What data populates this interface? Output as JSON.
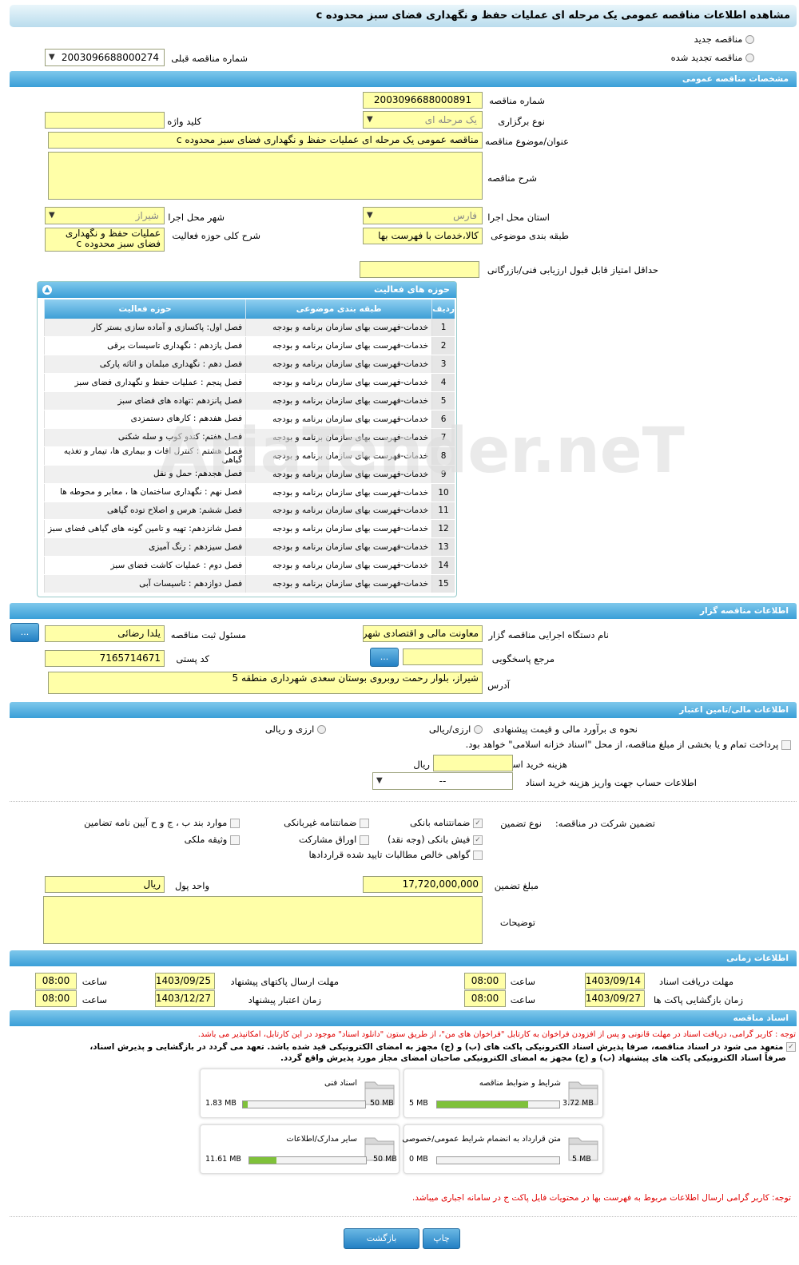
{
  "title": "مشاهده اطلاعات مناقصه عمومی یک مرحله ای عملیات حفظ و نگهداری فضای سبز محدوده c",
  "top": {
    "new_label": "مناقصه جدید",
    "renewed_label": "مناقصه تجدید شده",
    "prev_number_label": "شماره مناقصه قبلی",
    "prev_number_value": "2003096688000274"
  },
  "general": {
    "header": "مشخصات مناقصه عمومی",
    "number_label": "شماره مناقصه",
    "number_value": "2003096688000891",
    "type_label": "نوع برگزاری",
    "type_value": "یک مرحله ای",
    "keyword_label": "کلید واژه",
    "keyword_value": "",
    "subject_label": "عنوان/موضوع مناقصه",
    "subject_value": "مناقصه عمومی یک مرحله ای عملیات حفظ و نگهداری فضای سبز محدوده c",
    "desc_label": "شرح مناقصه",
    "desc_value": "",
    "province_label": "استان محل اجرا",
    "province_value": "فارس",
    "city_label": "شهر محل اجرا",
    "city_value": "شیراز",
    "category_label": "طبقه بندی موضوعی",
    "category_value": "کالا،خدمات با فهرست بها",
    "scope_label": "شرح کلی حوزه فعالیت",
    "scope_value": "عملیات حفظ و نگهداری فضای سبز محدوده c",
    "min_score_label": "حداقل امتیاز قابل قبول ارزیابی فنی/بازرگانی",
    "min_score_value": ""
  },
  "activities": {
    "header": "حوزه های فعالیت",
    "col_no": "ردیف",
    "col_cat": "طبقه بندی موضوعی",
    "col_act": "حوزه فعالیت",
    "rows": [
      [
        "1",
        "خدمات-فهرست بهای سازمان برنامه و بودجه",
        "فصل اول:  پاکسازی و آماده سازی بستر کار"
      ],
      [
        "2",
        "خدمات-فهرست بهای سازمان برنامه و بودجه",
        "فصل یازدهم : نگهداری تاسیسات برقی"
      ],
      [
        "3",
        "خدمات-فهرست بهای سازمان برنامه و بودجه",
        "فصل دهم : نگهداری مبلمان و اثاثه پارکی"
      ],
      [
        "4",
        "خدمات-فهرست بهای سازمان برنامه و بودجه",
        "فصل پنجم : عملیات حفظ و نگهداری فضای سبز"
      ],
      [
        "5",
        "خدمات-فهرست بهای سازمان برنامه و بودجه",
        "فصل پانزدهم :تهاده های فضای سبز"
      ],
      [
        "6",
        "خدمات-فهرست بهای سازمان برنامه و بودجه",
        "فصل هفدهم : کارهای دستمزدی"
      ],
      [
        "7",
        "خدمات-فهرست بهای سازمان برنامه و بودجه",
        "فصل هفتم: کندو کوب و سله شکنی"
      ],
      [
        "8",
        "خدمات-فهرست بهای سازمان برنامه و بودجه",
        "فصل هشتم : کنترل آفات و بیماری ها، تیمار و تغذیه گیاهی"
      ],
      [
        "9",
        "خدمات-فهرست بهای سازمان برنامه و بودجه",
        "فصل هجدهم: حمل و نقل"
      ],
      [
        "10",
        "خدمات-فهرست بهای سازمان برنامه و بودجه",
        "فصل نهم : نگهداری ساختمان ها ، معابر و محوطه ها"
      ],
      [
        "11",
        "خدمات-فهرست بهای سازمان برنامه و بودجه",
        "فصل ششم: هرس و اصلاح توده گیاهی"
      ],
      [
        "12",
        "خدمات-فهرست بهای سازمان برنامه و بودجه",
        "فصل شانزدهم: تهیه و تامین گونه های گیاهی فضای سبز"
      ],
      [
        "13",
        "خدمات-فهرست بهای سازمان برنامه و بودجه",
        "فصل سیزدهم : رنگ آمیزی"
      ],
      [
        "14",
        "خدمات-فهرست بهای سازمان برنامه و بودجه",
        "فصل دوم : عملیات کاشت فضای سبز"
      ],
      [
        "15",
        "خدمات-فهرست بهای سازمان برنامه و بودجه",
        "فصل دوازدهم : تاسیسات آبی"
      ]
    ]
  },
  "organizer": {
    "header": "اطلاعات مناقصه گزار",
    "org_label": "نام دستگاه اجرایی مناقصه گزار",
    "org_value": "معاونت مالی و اقتصادی شهرداری شیراز",
    "resp_label": "مسئول ثبت مناقصه",
    "resp_value": "یلدا رضائی",
    "ref_label": "مرجع پاسخگویی",
    "ref_value": "",
    "postal_label": "کد پستی",
    "postal_value": "7165714671",
    "address_label": "آدرس",
    "address_value": "شیراز، بلوار رحمت روبروی بوستان سعدی شهرداری  منطقه 5",
    "btn_label": "..."
  },
  "finance": {
    "header": "اطلاعات مالی/تامین اعتبار",
    "estimate_label": "نحوه ی برآورد مالی و قیمت پیشنهادی",
    "opt1": "ارزی/ریالی",
    "opt2": "ارزی و ریالی",
    "treasury_text": "پرداخت تمام و یا بخشی از مبلغ مناقصه، از محل \"اسناد خزانه اسلامی\" خواهد بود.",
    "doc_fee_label": "هزینه خرید اسناد",
    "doc_fee_unit": "ریال",
    "doc_fee_value": "",
    "account_label": "اطلاعات حساب جهت واریز هزینه خرید اسناد",
    "account_value": "--"
  },
  "guarantee": {
    "label": "تضمین شرکت در مناقصه:",
    "type_label": "نوع تضمین",
    "opts": [
      "ضمانتنامه بانکی",
      "ضمانتنامه غیربانکی",
      "موارد بند ب ، ج و ح آیین نامه تضامین",
      "فیش بانکی (وجه نقد)",
      "اوراق مشارکت",
      "وثیقه ملکی",
      "گواهی خالص مطالبات تایید شده قراردادها"
    ],
    "amount_label": "مبلغ تضمین",
    "amount_value": "17,720,000,000",
    "currency_label": "واحد پول",
    "currency_value": "ریال",
    "notes_label": "توضیحات",
    "notes_value": ""
  },
  "timing": {
    "header": "اطلاعات زمانی",
    "doc_receive_label": "مهلت دریافت اسناد",
    "doc_receive_date": "1403/09/14",
    "doc_receive_time": "08:00",
    "send_label": "مهلت ارسال پاکتهای پیشنهاد",
    "send_date": "1403/09/25",
    "send_time": "08:00",
    "open_label": "زمان بازگشایی پاکت ها",
    "open_date": "1403/09/27",
    "open_time": "08:00",
    "valid_label": "زمان اعتبار پیشنهاد",
    "valid_date": "1403/12/27",
    "valid_time": "08:00",
    "time_label": "ساعت"
  },
  "docs": {
    "header": "اسناد مناقصه",
    "note1": "توجه : کاربر گرامی، دریافت اسناد در مهلت قانونی و پس از افزودن فراخوان به کارتابل \"فراخوان های من\"، از طریق ستون \"دانلود اسناد\" موجود در این کارتابل، امکانپذیر می باشد.",
    "note2a": "متعهد می شود در اسناد مناقصه، صرفاً پذیرش اسناد الکترونیکی پاکت های (ب) و (ج) مجهز به امضای الکترونیکی قید شده باشد. تعهد می گردد در بازگشایی و پذیرش اسناد،",
    "note2b": "صرفاً اسناد الکترونیکی پاکت های پیشنهاد (ب) و (ج) مجهز به امضای الکترونیکی صاحبان امضای مجاز مورد پذیرش واقع گردد.",
    "items": [
      {
        "title": "شرایط و ضوابط مناقصه",
        "used": "3.72 MB",
        "max": "5 MB",
        "ratio": 0.744
      },
      {
        "title": "اسناد فنی",
        "used": "1.83 MB",
        "max": "50 MB",
        "ratio": 0.04
      },
      {
        "title": "متن قرارداد به انضمام شرایط عمومی/خصوصی",
        "used": "0 MB",
        "max": "5 MB",
        "ratio": 0
      },
      {
        "title": "سایر مدارک/اطلاعات",
        "used": "11.61 MB",
        "max": "50 MB",
        "ratio": 0.23
      }
    ],
    "note3": "توجه: کاربر گرامی ارسال اطلاعات مربوط به فهرست بها در محتویات فایل پاکت ج در سامانه اجباری میباشد."
  },
  "buttons": {
    "back": "بازگشت",
    "print": "چاپ"
  },
  "watermark": "AriaTender.neT",
  "colors": {
    "header_blue": "#3a9fd8",
    "field_yellow": "#ffffa8",
    "progress_green": "#7fc13a",
    "note_red": "#e00000"
  }
}
